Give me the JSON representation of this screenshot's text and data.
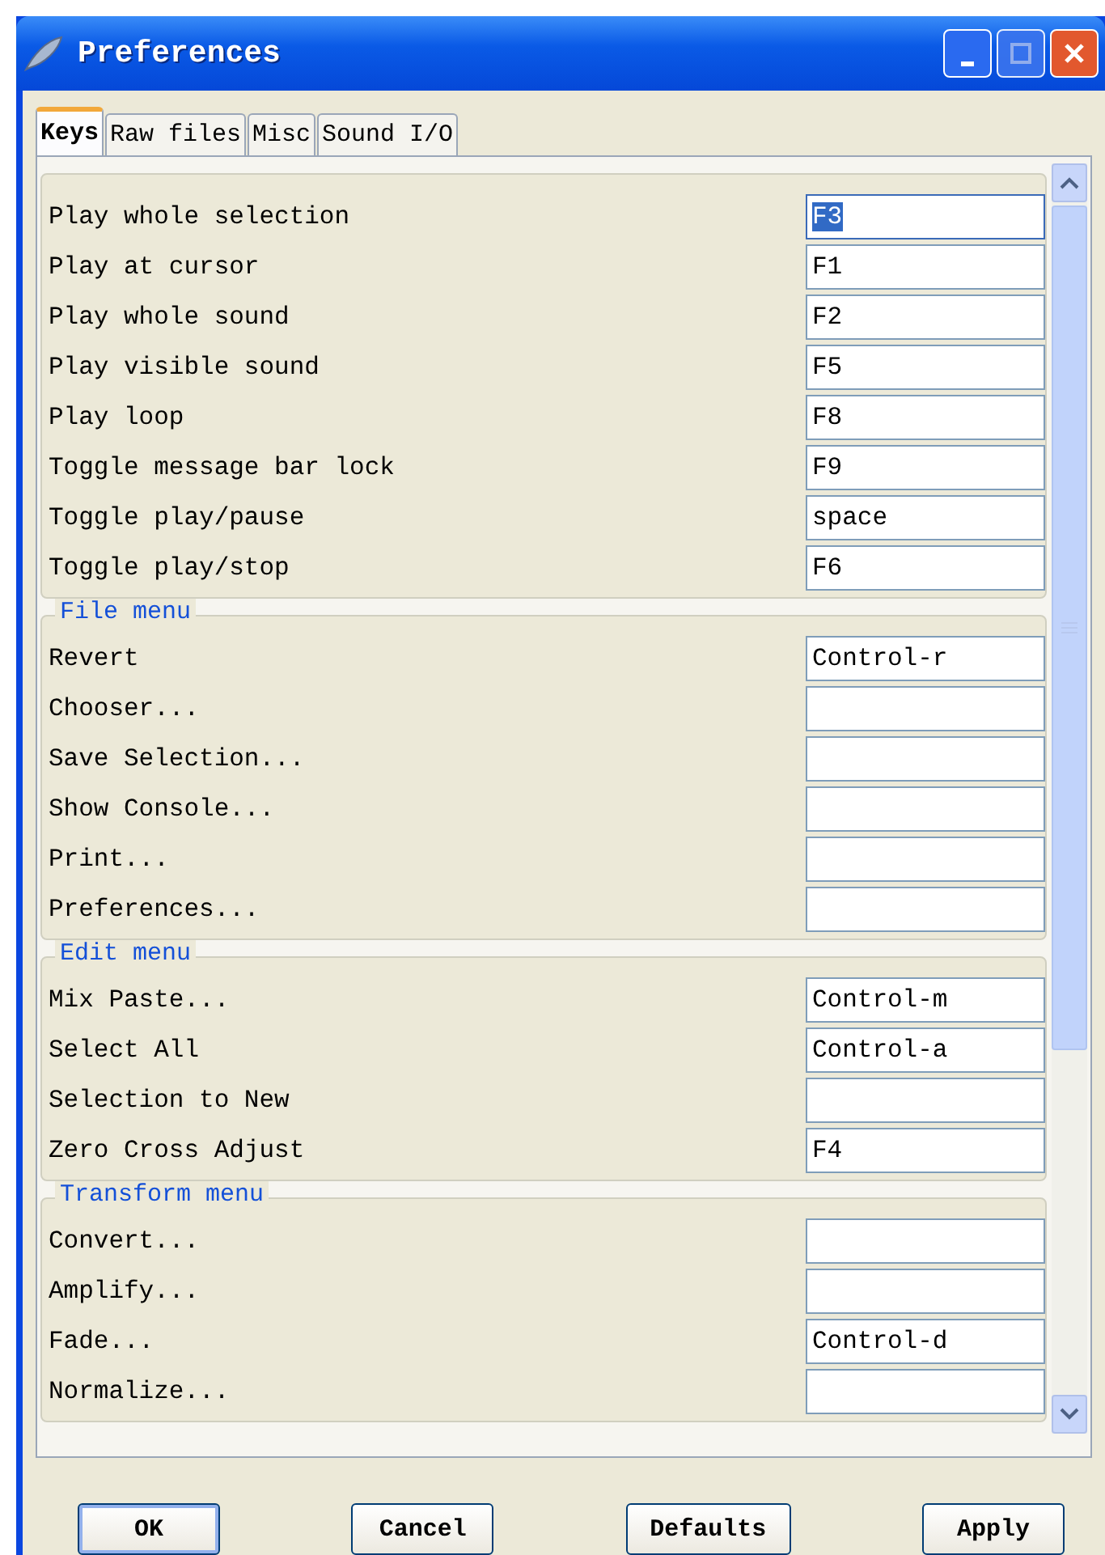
{
  "window": {
    "title": "Preferences"
  },
  "tabs": [
    {
      "label": "Keys",
      "selected": true
    },
    {
      "label": "Raw files",
      "selected": false
    },
    {
      "label": "Misc",
      "selected": false
    },
    {
      "label": "Sound I/O",
      "selected": false
    }
  ],
  "groups": [
    {
      "rows": [
        {
          "label": "Play whole selection",
          "value": "F3",
          "selected": true
        },
        {
          "label": "Play at cursor",
          "value": "F1",
          "selected": false
        },
        {
          "label": "Play whole sound",
          "value": "F2",
          "selected": false
        },
        {
          "label": "Play visible sound",
          "value": "F5",
          "selected": false
        },
        {
          "label": "Play loop",
          "value": "F8",
          "selected": false
        },
        {
          "label": "Toggle message bar lock",
          "value": "F9",
          "selected": false
        },
        {
          "label": "Toggle play/pause",
          "value": "space",
          "selected": false
        },
        {
          "label": "Toggle play/stop",
          "value": "F6",
          "selected": false
        }
      ]
    },
    {
      "title": "File menu",
      "rows": [
        {
          "label": "Revert",
          "value": "Control-r",
          "selected": false
        },
        {
          "label": "Chooser...",
          "selected": false
        },
        {
          "label": "Save Selection...",
          "selected": false
        },
        {
          "label": "Show Console...",
          "selected": false
        },
        {
          "label": "Print...",
          "selected": false
        },
        {
          "label": "Preferences...",
          "selected": false
        }
      ]
    },
    {
      "title": "Edit menu",
      "rows": [
        {
          "label": "Mix Paste...",
          "value": "Control-m",
          "selected": false
        },
        {
          "label": "Select All",
          "value": "Control-a",
          "selected": false
        },
        {
          "label": "Selection to New",
          "selected": false
        },
        {
          "label": "Zero Cross Adjust",
          "value": "F4",
          "selected": false
        }
      ]
    },
    {
      "title": "Transform menu",
      "rows": [
        {
          "label": "Convert...",
          "selected": false
        },
        {
          "label": "Amplify...",
          "selected": false
        },
        {
          "label": "Fade...",
          "value": "Control-d",
          "selected": false
        },
        {
          "label": "Normalize...",
          "selected": false
        }
      ]
    }
  ],
  "buttons": [
    "OK",
    "Cancel",
    "Defaults",
    "Apply"
  ]
}
